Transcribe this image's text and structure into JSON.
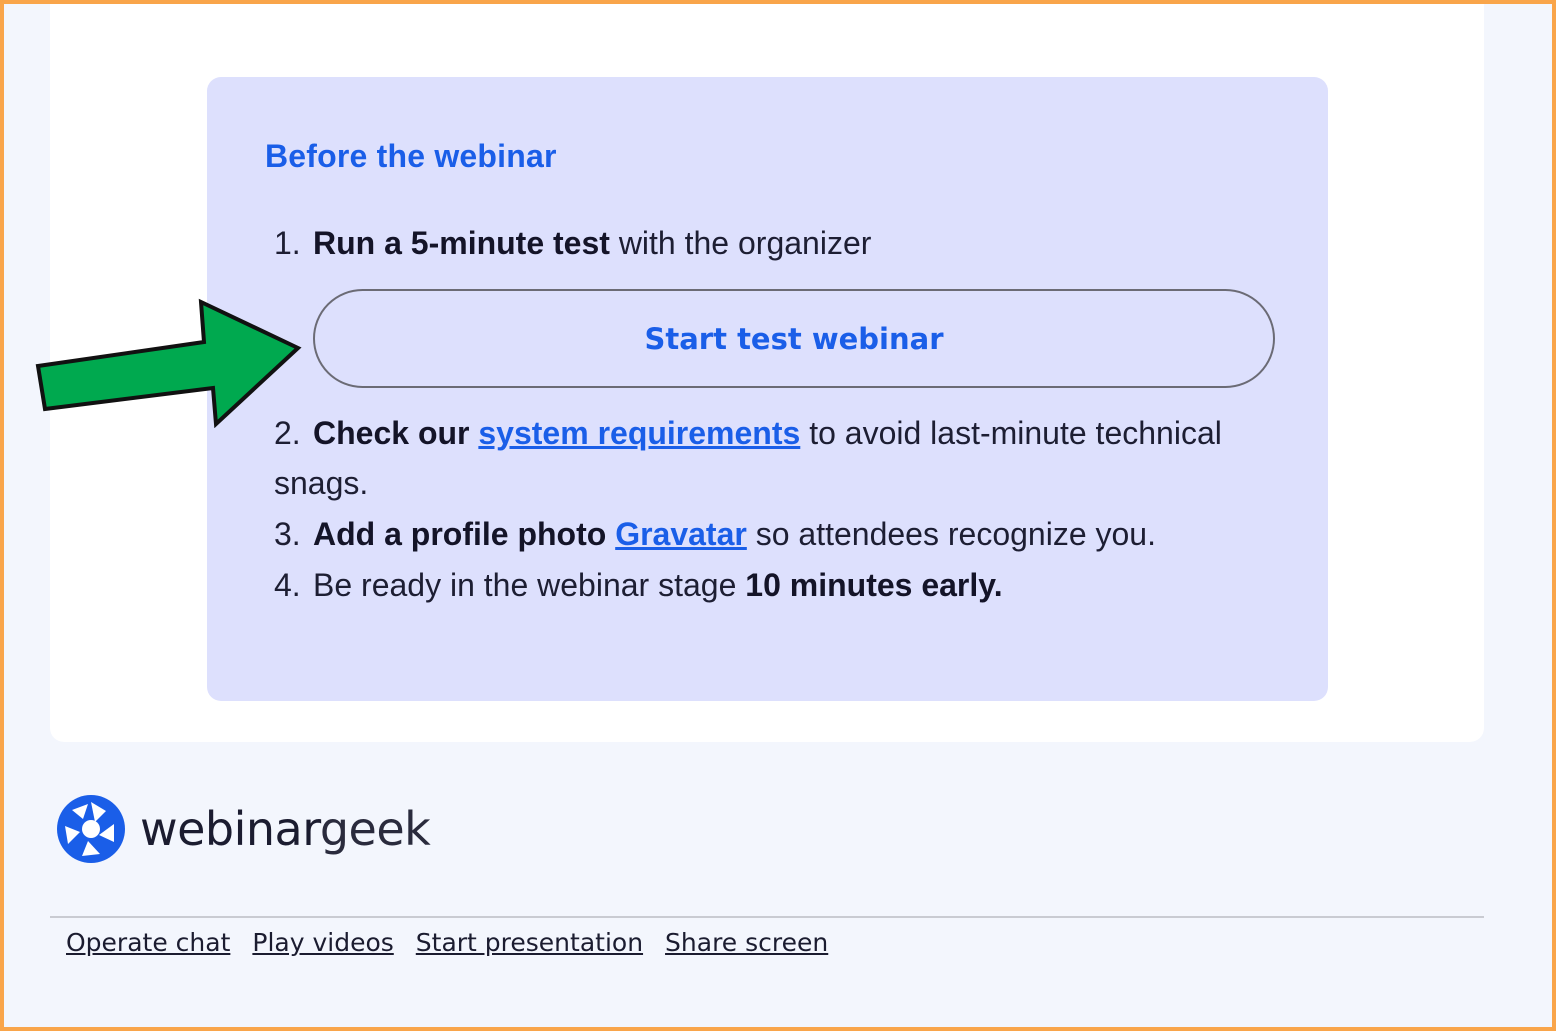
{
  "info": {
    "title": "Before the webinar",
    "steps": [
      {
        "num": "1.",
        "bold": "Run a 5-minute test",
        "text": " with the organizer"
      },
      {
        "num": "2.",
        "bold": "Check our ",
        "link": "system requirements",
        "text": " to avoid last-minute technical snags."
      },
      {
        "num": "3.",
        "bold": "Add a profile photo ",
        "link": "Gravatar",
        "text": " so attendees recognize you."
      },
      {
        "num": "4.",
        "text": "Be ready in the webinar stage ",
        "bold": "10 minutes early."
      }
    ],
    "test_button_label": "Start test webinar"
  },
  "logo": {
    "brand_part1": "webinar",
    "brand_part2": "geek"
  },
  "footer": {
    "links": [
      "Operate chat ",
      "Play videos ",
      "Start presentation ",
      "Share screen"
    ]
  },
  "colors": {
    "accent": "#1a5ee8",
    "panel": "#dde0fd",
    "arrow": "#00a94f",
    "frame": "#f9a54a"
  }
}
